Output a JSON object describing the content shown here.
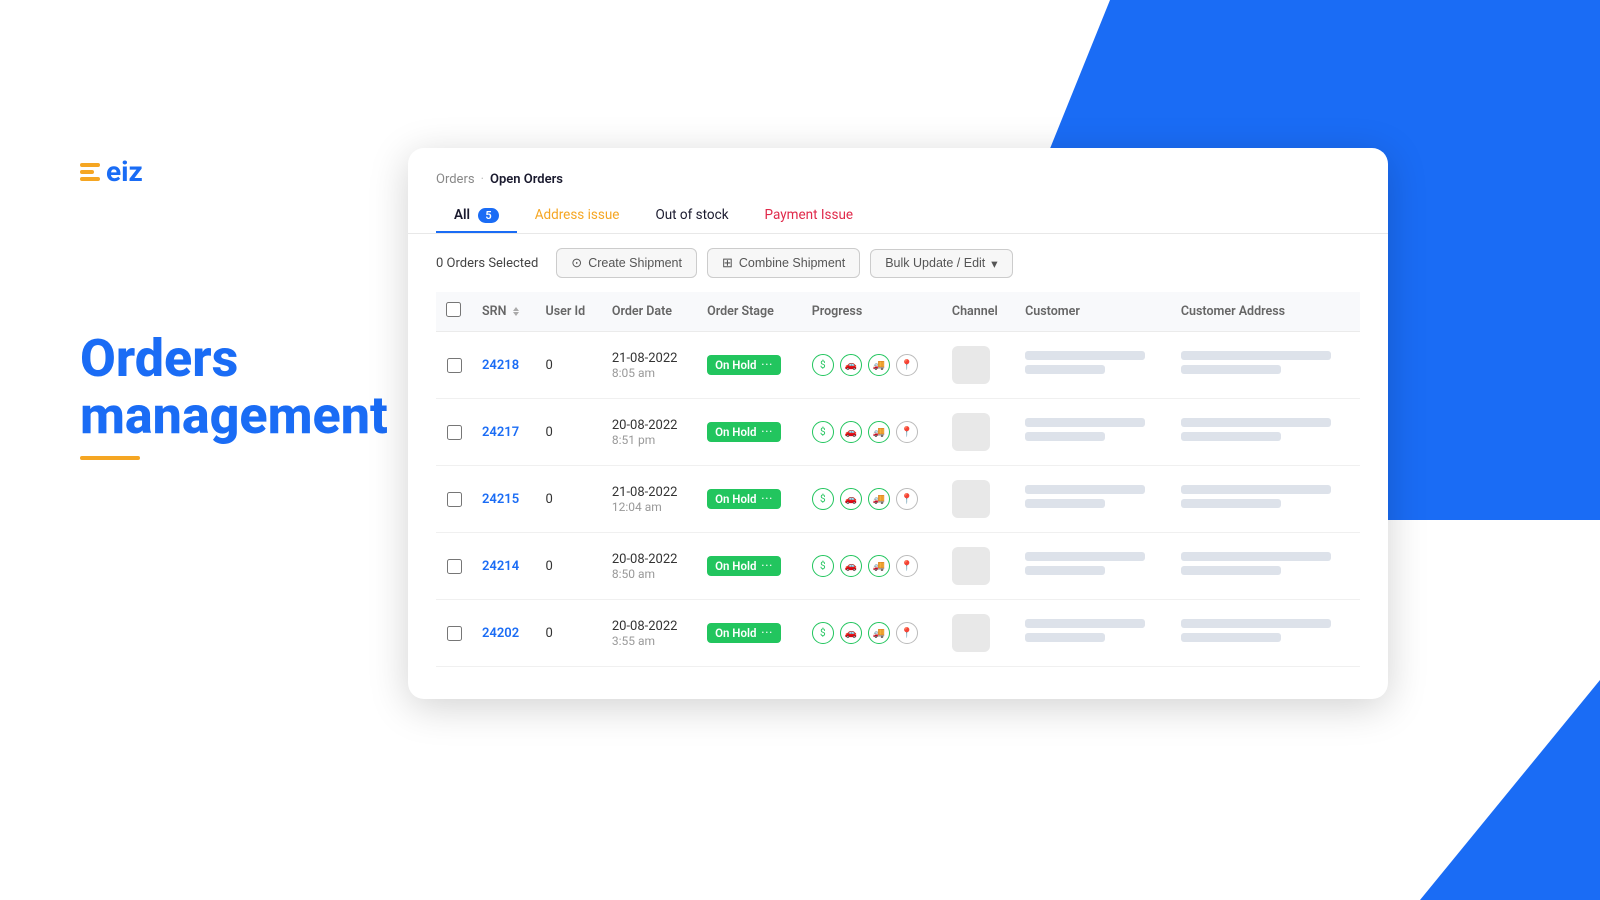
{
  "background": {
    "blue_color": "#1a6cf5",
    "accent_color": "#f5a623"
  },
  "logo": {
    "text": "eiz",
    "icon_bars": [
      20,
      14,
      20
    ]
  },
  "hero": {
    "line1": "Orders",
    "line2": "management"
  },
  "panel": {
    "breadcrumb": {
      "parent": "Orders",
      "current": "Open Orders",
      "separator": "·"
    },
    "tabs": [
      {
        "id": "all",
        "label": "All",
        "badge": "5",
        "active": true
      },
      {
        "id": "address",
        "label": "Address issue",
        "active": false
      },
      {
        "id": "out",
        "label": "Out of stock",
        "active": false
      },
      {
        "id": "payment",
        "label": "Payment Issue",
        "active": false
      }
    ],
    "toolbar": {
      "selected_label": "0 Orders Selected",
      "create_shipment": "Create Shipment",
      "combine_shipment": "Combine Shipment",
      "bulk_update": "Bulk Update / Edit"
    },
    "table": {
      "columns": [
        "SRN",
        "User Id",
        "Order Date",
        "Order Stage",
        "Progress",
        "Channel",
        "Customer",
        "Customer Address"
      ],
      "rows": [
        {
          "id": "24218",
          "user_id": "0",
          "order_date": "21-08-2022",
          "order_time": "8:05 am",
          "stage": "On Hold",
          "progress": [
            "dollar",
            "car",
            "truck",
            "pin"
          ]
        },
        {
          "id": "24217",
          "user_id": "0",
          "order_date": "20-08-2022",
          "order_time": "8:51 pm",
          "stage": "On Hold",
          "progress": [
            "dollar",
            "car",
            "truck",
            "pin"
          ]
        },
        {
          "id": "24215",
          "user_id": "0",
          "order_date": "21-08-2022",
          "order_time": "12:04 am",
          "stage": "On Hold",
          "progress": [
            "dollar",
            "car",
            "truck",
            "pin"
          ]
        },
        {
          "id": "24214",
          "user_id": "0",
          "order_date": "20-08-2022",
          "order_time": "8:50 am",
          "stage": "On Hold",
          "progress": [
            "dollar",
            "car",
            "truck",
            "pin"
          ]
        },
        {
          "id": "24202",
          "user_id": "0",
          "order_date": "20-08-2022",
          "order_time": "3:55 am",
          "stage": "On Hold",
          "progress": [
            "dollar",
            "car",
            "truck",
            "pin"
          ]
        }
      ]
    }
  }
}
